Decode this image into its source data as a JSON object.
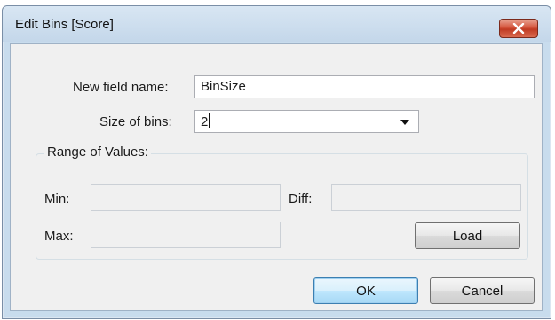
{
  "dialog": {
    "title": "Edit Bins [Score]",
    "close_symbol": "×"
  },
  "form": {
    "field_name_label": "New field name:",
    "field_name_value": "BinSize",
    "bin_size_label": "Size of bins:",
    "bin_size_value": "2"
  },
  "range": {
    "legend": "Range of Values:",
    "min_label": "Min:",
    "min_value": "",
    "max_label": "Max:",
    "max_value": "",
    "diff_label": "Diff:",
    "diff_value": "",
    "load_label": "Load"
  },
  "buttons": {
    "ok_label": "OK",
    "cancel_label": "Cancel"
  },
  "icons": {
    "close": "close-icon",
    "dropdown": "chevron-down-icon"
  },
  "colors": {
    "titlebar": "#c8dced",
    "close_button": "#c8452c",
    "client_bg": "#f0f0f0",
    "default_button": "#bee6fd"
  }
}
